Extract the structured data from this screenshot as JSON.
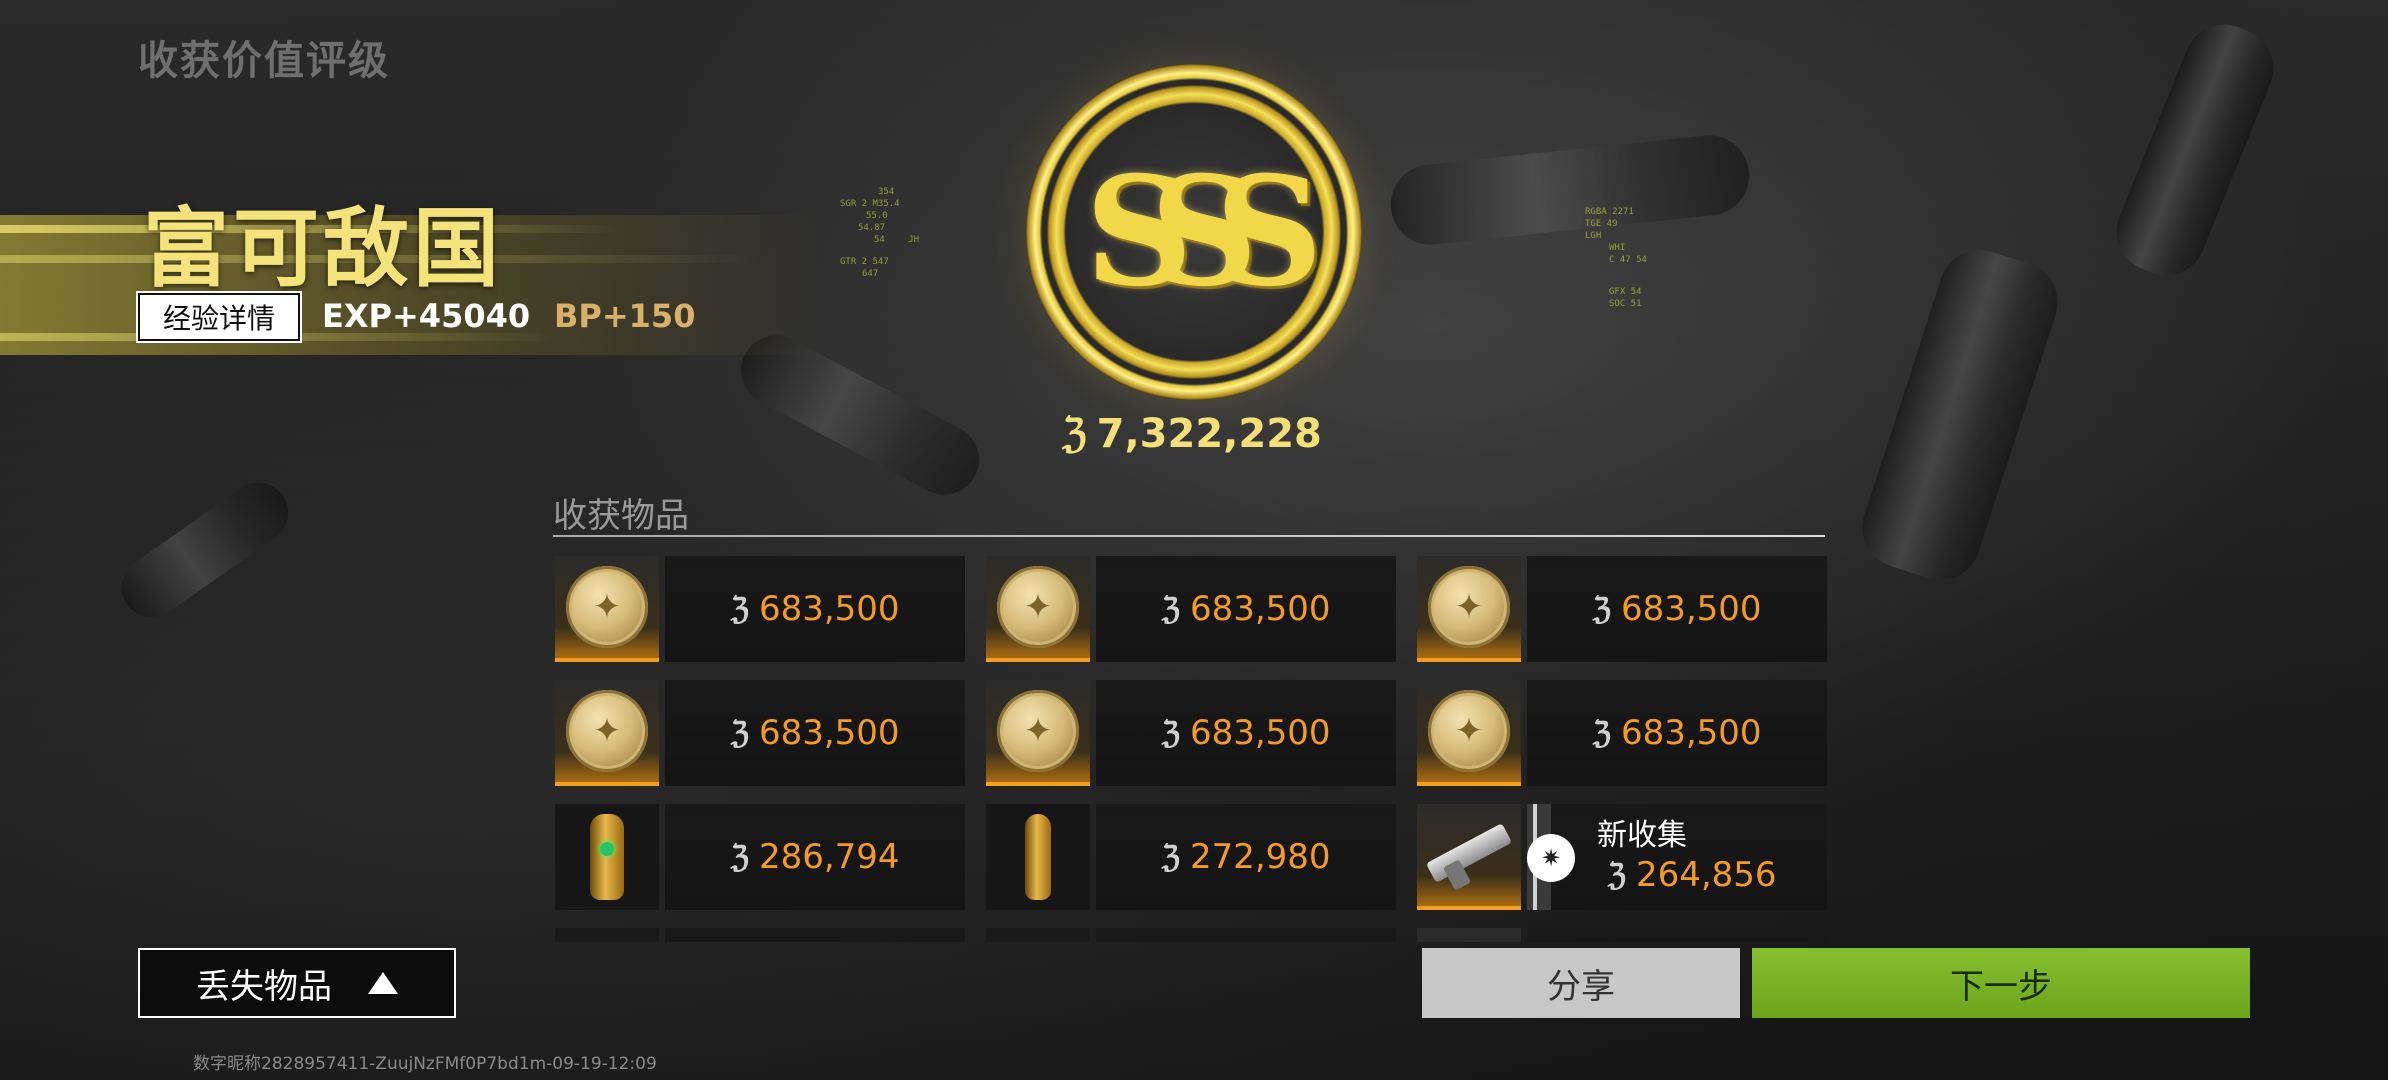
{
  "page": {
    "heading": "收获价值评级"
  },
  "rank": {
    "title": "富可敌国",
    "exp_details_label": "经验详情",
    "exp": "EXP+45040",
    "bp": "BP+150"
  },
  "grade": {
    "letter": "SSS",
    "total_value": "7,322,228",
    "currency_icon": "coin-icon"
  },
  "items": {
    "header": "收获物品",
    "list": [
      {
        "icon": "gold-coin-icon",
        "price": "683,500",
        "new": false
      },
      {
        "icon": "gold-coin-icon",
        "price": "683,500",
        "new": false
      },
      {
        "icon": "gold-coin-icon",
        "price": "683,500",
        "new": false
      },
      {
        "icon": "gold-coin-icon",
        "price": "683,500",
        "new": false
      },
      {
        "icon": "gold-coin-icon",
        "price": "683,500",
        "new": false
      },
      {
        "icon": "gold-coin-icon",
        "price": "683,500",
        "new": false
      },
      {
        "icon": "gold-bracer-icon",
        "price": "286,794",
        "new": false
      },
      {
        "icon": "gold-bracer-icon",
        "price": "272,980",
        "new": false
      },
      {
        "icon": "rifle-icon",
        "price": "264,856",
        "new": true,
        "new_label": "新收集"
      }
    ]
  },
  "buttons": {
    "lost_items": "丢失物品",
    "share": "分享",
    "next": "下一步"
  },
  "footer": {
    "player_id": "数字昵称2828957411-ZuujNzFMf0P7bd1m-09-19-12:09"
  },
  "hud_text": {
    "left": [
      "354",
      "SGR 2 M35.4",
      "55.0",
      "54.87",
      "54",
      "JH",
      "GTR 2 547",
      "647"
    ],
    "right": [
      "RGBA 2271",
      "TGE 49",
      "LGH",
      "WHI",
      "C 47 54",
      "GFX 54",
      "SOC 51"
    ]
  },
  "colors": {
    "accent_gold": "#f4e27a",
    "price_orange": "#f39b24",
    "next_green": "#7bb325",
    "share_gray": "#c7c7c7"
  }
}
